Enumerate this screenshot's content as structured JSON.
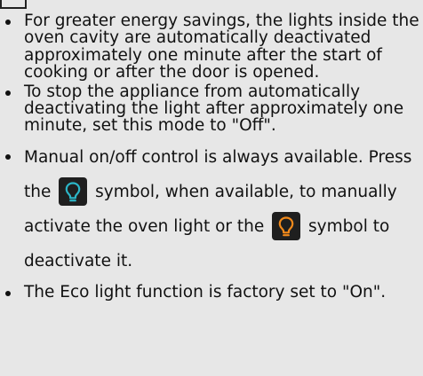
{
  "colors": {
    "background": "#e7e7e7",
    "bulb_on_bg": "#1f1f1f",
    "bulb_on_fg": "#2cb6c8",
    "bulb_off_bg": "#1f1f1f",
    "bulb_off_fg": "#f28a1b"
  },
  "bullets": [
    {
      "text": "For greater energy savings, the lights inside the oven cavity are automatically deactivated approximately one minute after the start of cooking or after the door is opened."
    },
    {
      "text": "To stop the appliance from automatically deactivating the light after approximately one minute, set this mode to \"Off\"."
    },
    {
      "part1": "Manual on/off control is always available. Press the",
      "icon1": "lightbulb-cyan-icon",
      "part2": "symbol, when available, to manually activate the oven light or the",
      "icon2": "lightbulb-orange-icon",
      "part3": "symbol to deactivate it."
    },
    {
      "text": "The Eco light function is factory set to \"On\"."
    }
  ]
}
